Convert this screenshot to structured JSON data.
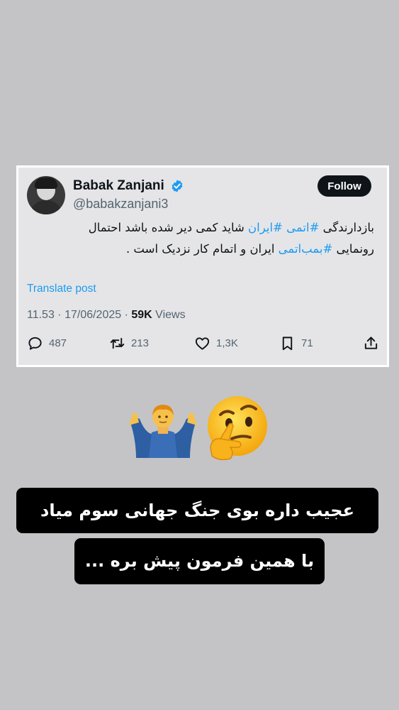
{
  "tweet": {
    "display_name": "Babak Zanjani",
    "handle": "@babakzanjani3",
    "follow_label": "Follow",
    "line1": {
      "before": "بازدارندگی ",
      "tag1": "#اتمی",
      "between": " ",
      "tag2": "#ایران",
      "after": " شاید کمی دیر شده باشد احتمال"
    },
    "line2": {
      "before": "رونمایی ",
      "tag": "#بمب‌اتمی",
      "after": " ایران و اتمام کار نزدیک است ."
    },
    "translate_label": "Translate post",
    "time_date": "11.53 · 17/06/2025 · ",
    "views_count": "59K",
    "views_label": " Views",
    "replies": "487",
    "reposts": "213",
    "likes": "1,3K",
    "bookmarks": "71"
  },
  "icons": [
    "verified-badge-icon",
    "reply-icon",
    "repost-icon",
    "like-icon",
    "bookmark-icon",
    "share-icon",
    "man-shrugging-emoji",
    "thinking-face-emoji"
  ],
  "captions": {
    "line1": "عجیب داره بوی جنگ جهانی سوم میاد",
    "line2": "با همین فرمون پیش بره ..."
  },
  "colors": {
    "link": "#1d9bf0",
    "text": "#0f1419",
    "muted": "#536471",
    "caption_bg": "#000000"
  }
}
